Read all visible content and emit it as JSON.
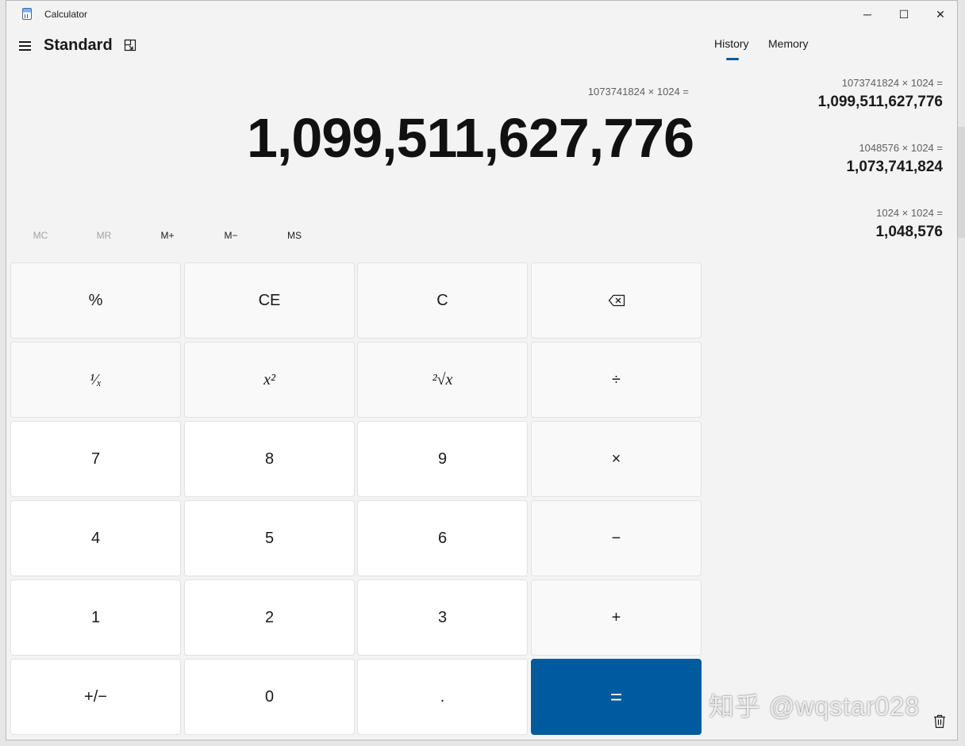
{
  "window": {
    "title": "Calculator",
    "minimize": "─",
    "maximize": "☐",
    "close": "✕"
  },
  "header": {
    "mode": "Standard"
  },
  "display": {
    "expression": "1073741824 × 1024 =",
    "value": "1,099,511,627,776"
  },
  "memory_keys": [
    {
      "label": "MC",
      "enabled": false
    },
    {
      "label": "MR",
      "enabled": false
    },
    {
      "label": "M+",
      "enabled": true
    },
    {
      "label": "M−",
      "enabled": true
    },
    {
      "label": "MS",
      "enabled": true
    }
  ],
  "keypad": [
    [
      "%",
      "CE",
      "C",
      "⌫"
    ],
    [
      "¹⁄ₓ",
      "x²",
      "²√x",
      "÷"
    ],
    [
      "7",
      "8",
      "9",
      "×"
    ],
    [
      "4",
      "5",
      "6",
      "−"
    ],
    [
      "1",
      "2",
      "3",
      "+"
    ],
    [
      "+/−",
      "0",
      ".",
      "="
    ]
  ],
  "tabs": {
    "history": "History",
    "memory": "Memory",
    "active": "history"
  },
  "history": [
    {
      "expression": "1073741824 × 1024 =",
      "result": "1,099,511,627,776"
    },
    {
      "expression": "1048576 × 1024 =",
      "result": "1,073,741,824"
    },
    {
      "expression": "1024 × 1024 =",
      "result": "1,048,576"
    }
  ],
  "watermark": "知乎 @wqstar028",
  "colors": {
    "accent": "#005a9e",
    "background": "#f3f3f3"
  },
  "icons": [
    "calculator-app-icon",
    "hamburger-menu-icon",
    "keep-on-top-icon",
    "backspace-icon",
    "trash-icon"
  ]
}
